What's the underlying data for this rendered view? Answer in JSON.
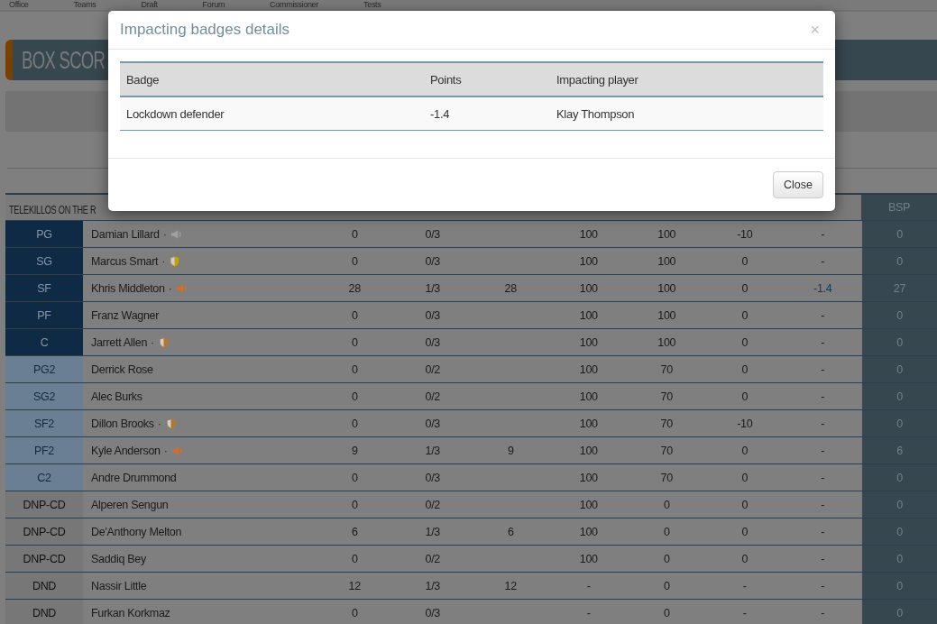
{
  "nav": {
    "items": [
      "Office",
      "Teams",
      "Draft",
      "Forum",
      "Commissioner",
      "Tests"
    ]
  },
  "page_title": "BOX SCOR",
  "box_score": {
    "team_header": "TELEKILLOS ON THE R",
    "bsp_header": "BSP",
    "rows": [
      {
        "position": "PG",
        "kind": "starter",
        "player": "Damian Lillard",
        "badge": {
          "separator": "·",
          "kind": "megaphone",
          "color": "#a0a0a0"
        },
        "column_3": "0",
        "column_4": "0/3",
        "column_6": "100",
        "column_7": "100",
        "column_8": "-10",
        "column_9": "-",
        "column_9_link": false,
        "bsp": "0"
      },
      {
        "position": "SG",
        "kind": "starter",
        "player": "Marcus Smart",
        "badge": {
          "separator": "·",
          "kind": "shield",
          "color": "#c8a000"
        },
        "column_3": "0",
        "column_4": "0/3",
        "column_6": "100",
        "column_7": "100",
        "column_8": "0",
        "column_9": "-",
        "column_9_link": false,
        "bsp": "0"
      },
      {
        "position": "SF",
        "kind": "starter",
        "player": "Khris Middleton",
        "badge": {
          "separator": "·",
          "kind": "megaphone",
          "color": "#d0702a"
        },
        "column_3": "28",
        "column_4": "1/3",
        "column_5": "28",
        "column_6": "100",
        "column_7": "100",
        "column_8": "0",
        "column_9": "-1.4",
        "column_9_link": true,
        "bsp": "27"
      },
      {
        "position": "PF",
        "kind": "starter",
        "player": "Franz Wagner",
        "column_3": "0",
        "column_4": "0/3",
        "column_6": "100",
        "column_7": "100",
        "column_8": "0",
        "column_9": "-",
        "column_9_link": false,
        "bsp": "0"
      },
      {
        "position": "C",
        "kind": "starter",
        "player": "Jarrett Allen",
        "badge": {
          "separator": "·",
          "kind": "shield",
          "color": "#b87428"
        },
        "column_3": "0",
        "column_4": "0/3",
        "column_6": "100",
        "column_7": "100",
        "column_8": "0",
        "column_9": "-",
        "column_9_link": false,
        "bsp": "0"
      },
      {
        "position": "PG2",
        "kind": "bench",
        "player": "Derrick Rose",
        "column_3": "0",
        "column_4": "0/2",
        "column_6": "100",
        "column_7": "70",
        "column_8": "0",
        "column_9": "-",
        "column_9_link": false,
        "bsp": "0"
      },
      {
        "position": "SG2",
        "kind": "bench",
        "player": "Alec Burks",
        "column_3": "0",
        "column_4": "0/2",
        "column_6": "100",
        "column_7": "70",
        "column_8": "0",
        "column_9": "-",
        "column_9_link": false,
        "bsp": "0"
      },
      {
        "position": "SF2",
        "kind": "bench",
        "player": "Dillon Brooks",
        "badge": {
          "separator": "·",
          "kind": "shield",
          "color": "#b87428"
        },
        "column_3": "0",
        "column_4": "0/3",
        "column_6": "100",
        "column_7": "70",
        "column_8": "-10",
        "column_9": "-",
        "column_9_link": false,
        "bsp": "0"
      },
      {
        "position": "PF2",
        "kind": "bench",
        "player": "Kyle Anderson",
        "badge": {
          "separator": "·",
          "kind": "megaphone",
          "color": "#d0702a"
        },
        "column_3": "9",
        "column_4": "1/3",
        "column_5": "9",
        "column_6": "100",
        "column_7": "70",
        "column_8": "0",
        "column_9": "-",
        "column_9_link": false,
        "bsp": "6"
      },
      {
        "position": "C2",
        "kind": "bench",
        "player": "Andre Drummond",
        "column_3": "0",
        "column_4": "0/3",
        "column_6": "100",
        "column_7": "70",
        "column_8": "0",
        "column_9": "-",
        "column_9_link": false,
        "bsp": "0"
      },
      {
        "position": "DNP-CD",
        "kind": "reserve",
        "player": "Alperen Sengun",
        "column_3": "0",
        "column_4": "0/2",
        "column_6": "100",
        "column_7": "0",
        "column_8": "0",
        "column_9": "-",
        "column_9_link": false,
        "bsp": "0"
      },
      {
        "position": "DNP-CD",
        "kind": "reserve",
        "player": "De'Anthony Melton",
        "column_3": "6",
        "column_4": "1/3",
        "column_5": "6",
        "column_6": "100",
        "column_7": "0",
        "column_8": "0",
        "column_9": "-",
        "column_9_link": false,
        "bsp": "0"
      },
      {
        "position": "DNP-CD",
        "kind": "reserve",
        "player": "Saddiq Bey",
        "column_3": "0",
        "column_4": "0/2",
        "column_6": "100",
        "column_7": "0",
        "column_8": "0",
        "column_9": "-",
        "column_9_link": false,
        "bsp": "0"
      },
      {
        "position": "DND",
        "kind": "reserve",
        "player": "Nassir Little",
        "column_3": "12",
        "column_4": "1/3",
        "column_5": "12",
        "column_6": "-",
        "column_7": "0",
        "column_8": "-",
        "column_9": "-",
        "column_9_link": false,
        "bsp": "0"
      },
      {
        "position": "DND",
        "kind": "reserve",
        "player": "Furkan Korkmaz",
        "column_3": "0",
        "column_4": "0/3",
        "column_6": "-",
        "column_7": "0",
        "column_8": "-",
        "column_9": "-",
        "column_9_link": false,
        "bsp": "0"
      }
    ]
  },
  "modal": {
    "title": "Impacting badges details",
    "close_glyph": "×",
    "columns": [
      "Badge",
      "Points",
      "Impacting player"
    ],
    "rows": [
      [
        "Lockdown defender",
        "-1.4",
        "Klay Thompson"
      ]
    ],
    "button": "Close"
  }
}
